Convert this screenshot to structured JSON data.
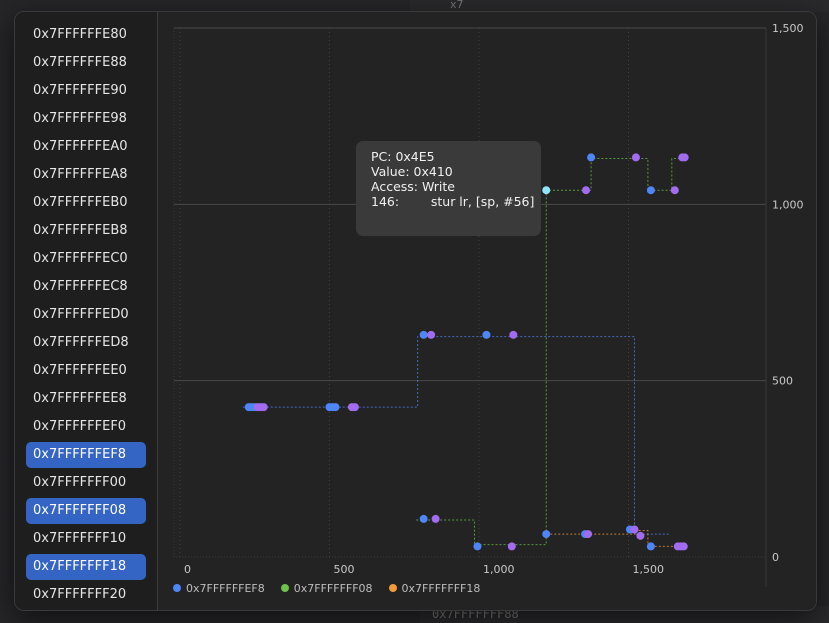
{
  "background": {
    "top_text": "x7",
    "bottom_text": "0x7FFFFFFF88"
  },
  "sidebar": {
    "items": [
      {
        "label": "0x7FFFFFFE80",
        "selected": false
      },
      {
        "label": "0x7FFFFFFE88",
        "selected": false
      },
      {
        "label": "0x7FFFFFFE90",
        "selected": false
      },
      {
        "label": "0x7FFFFFFE98",
        "selected": false
      },
      {
        "label": "0x7FFFFFFEA0",
        "selected": false
      },
      {
        "label": "0x7FFFFFFEA8",
        "selected": false
      },
      {
        "label": "0x7FFFFFFEB0",
        "selected": false
      },
      {
        "label": "0x7FFFFFFEB8",
        "selected": false
      },
      {
        "label": "0x7FFFFFFEC0",
        "selected": false
      },
      {
        "label": "0x7FFFFFFEC8",
        "selected": false
      },
      {
        "label": "0x7FFFFFFED0",
        "selected": false
      },
      {
        "label": "0x7FFFFFFED8",
        "selected": false
      },
      {
        "label": "0x7FFFFFFEE0",
        "selected": false
      },
      {
        "label": "0x7FFFFFFEE8",
        "selected": false
      },
      {
        "label": "0x7FFFFFFEF0",
        "selected": false
      },
      {
        "label": "0x7FFFFFFEF8",
        "selected": true
      },
      {
        "label": "0x7FFFFFFF00",
        "selected": false
      },
      {
        "label": "0x7FFFFFFF08",
        "selected": true
      },
      {
        "label": "0x7FFFFFFF10",
        "selected": false
      },
      {
        "label": "0x7FFFFFFF18",
        "selected": true
      },
      {
        "label": "0x7FFFFFFF20",
        "selected": false
      }
    ]
  },
  "tooltip": {
    "pc": "PC: 0x4E5",
    "value": "Value: 0x410",
    "access": "Access: Write",
    "instr": "146:        stur lr, [sp, #56]"
  },
  "colors": {
    "read": "#a36bf0",
    "write": "#4f86f7",
    "highlight": "#8fe4f7",
    "series": [
      "#4f86f7",
      "#6cc24a",
      "#f19a38"
    ],
    "selected_bg": "#3565c4"
  },
  "chart_data": {
    "type": "scatter",
    "xlim": [
      -20,
      1960
    ],
    "ylim": [
      0,
      1500
    ],
    "x_ticks": [
      0,
      500,
      1000,
      1500
    ],
    "x_tick_labels": [
      "0",
      "500",
      "1,000",
      "1,500"
    ],
    "y_ticks": [
      0,
      500,
      1000,
      1500
    ],
    "y_tick_labels": [
      "0",
      "500",
      "1,000",
      "1,500"
    ],
    "grid": true,
    "legend_position": "bottom-left",
    "series": [
      {
        "name": "0x7FFFFFFEF8",
        "color": "#4f86f7",
        "steps": [
          [
            210,
            425
          ],
          [
            795,
            425
          ],
          [
            795,
            625
          ],
          [
            1520,
            625
          ],
          [
            1520,
            65
          ],
          [
            1640,
            65
          ]
        ],
        "points": [
          {
            "x": 230,
            "y": 425,
            "kind": "write"
          },
          {
            "x": 240,
            "y": 425,
            "kind": "write"
          },
          {
            "x": 250,
            "y": 425,
            "kind": "write"
          },
          {
            "x": 260,
            "y": 425,
            "kind": "read"
          },
          {
            "x": 270,
            "y": 425,
            "kind": "read"
          },
          {
            "x": 280,
            "y": 425,
            "kind": "read"
          },
          {
            "x": 500,
            "y": 425,
            "kind": "write"
          },
          {
            "x": 510,
            "y": 425,
            "kind": "write"
          },
          {
            "x": 520,
            "y": 425,
            "kind": "write"
          },
          {
            "x": 575,
            "y": 425,
            "kind": "read"
          },
          {
            "x": 585,
            "y": 425,
            "kind": "read"
          },
          {
            "x": 815,
            "y": 630,
            "kind": "write"
          },
          {
            "x": 840,
            "y": 630,
            "kind": "read"
          },
          {
            "x": 1025,
            "y": 630,
            "kind": "write"
          },
          {
            "x": 1115,
            "y": 630,
            "kind": "read"
          }
        ]
      },
      {
        "name": "0x7FFFFFFF08",
        "color": "#6cc24a",
        "steps": [
          [
            790,
            105
          ],
          [
            985,
            105
          ],
          [
            985,
            35
          ],
          [
            1225,
            35
          ],
          [
            1225,
            1040
          ],
          [
            1375,
            1040
          ],
          [
            1375,
            1130
          ],
          [
            1565,
            1130
          ],
          [
            1565,
            1040
          ],
          [
            1645,
            1040
          ],
          [
            1645,
            1130
          ],
          [
            1685,
            1130
          ]
        ],
        "points": [
          {
            "x": 815,
            "y": 108,
            "kind": "write"
          },
          {
            "x": 855,
            "y": 108,
            "kind": "read"
          },
          {
            "x": 995,
            "y": 30,
            "kind": "write"
          },
          {
            "x": 1110,
            "y": 30,
            "kind": "read"
          },
          {
            "x": 1225,
            "y": 1040,
            "kind": "highlight"
          },
          {
            "x": 1358,
            "y": 1040,
            "kind": "read"
          },
          {
            "x": 1375,
            "y": 1133,
            "kind": "write"
          },
          {
            "x": 1525,
            "y": 1133,
            "kind": "read"
          },
          {
            "x": 1575,
            "y": 1040,
            "kind": "write"
          },
          {
            "x": 1655,
            "y": 1040,
            "kind": "read"
          },
          {
            "x": 1680,
            "y": 1133,
            "kind": "read"
          },
          {
            "x": 1688,
            "y": 1133,
            "kind": "read"
          }
        ]
      },
      {
        "name": "0x7FFFFFFF18",
        "color": "#f19a38",
        "steps": [
          [
            1225,
            65
          ],
          [
            1350,
            65
          ],
          [
            1520,
            65
          ],
          [
            1520,
            75
          ],
          [
            1565,
            75
          ],
          [
            1565,
            30
          ],
          [
            1685,
            30
          ]
        ],
        "points": [
          {
            "x": 1225,
            "y": 65,
            "kind": "write"
          },
          {
            "x": 1355,
            "y": 65,
            "kind": "write"
          },
          {
            "x": 1365,
            "y": 65,
            "kind": "read"
          },
          {
            "x": 1505,
            "y": 78,
            "kind": "write"
          },
          {
            "x": 1520,
            "y": 78,
            "kind": "read"
          },
          {
            "x": 1540,
            "y": 60,
            "kind": "read"
          },
          {
            "x": 1575,
            "y": 30,
            "kind": "write"
          },
          {
            "x": 1665,
            "y": 30,
            "kind": "read"
          },
          {
            "x": 1675,
            "y": 30,
            "kind": "read"
          },
          {
            "x": 1685,
            "y": 30,
            "kind": "read"
          }
        ]
      }
    ]
  }
}
